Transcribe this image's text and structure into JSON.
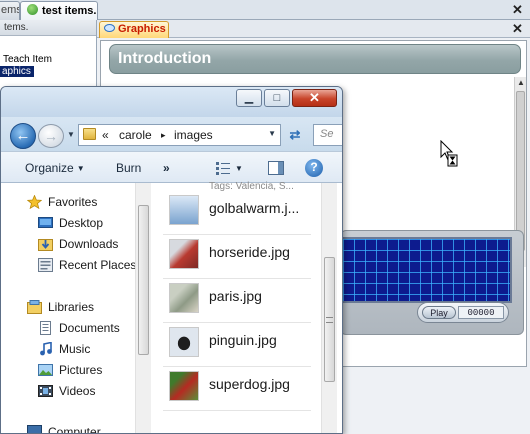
{
  "app": {
    "tabs": [
      {
        "label": "ems."
      },
      {
        "label": "test items."
      }
    ],
    "left_panel": {
      "header": "tems.",
      "tree": [
        {
          "label": "Teach Item"
        },
        {
          "label": "aphics",
          "selected": true
        }
      ]
    },
    "graphics_tab": {
      "label": "Graphics"
    },
    "slide": {
      "title": "Introduction"
    },
    "media_player": {
      "play_label": "Play",
      "counter": "00000"
    }
  },
  "explorer": {
    "window_buttons": {
      "minimize": "▁",
      "maximize": "□",
      "close": "✕"
    },
    "address": {
      "overflow": "«",
      "crumbs": [
        "carole",
        "images"
      ],
      "separator": "▸",
      "search_placeholder": "Se"
    },
    "toolbar": {
      "organize": "Organize",
      "burn": "Burn",
      "more": "»"
    },
    "nav_pane": {
      "sections": [
        {
          "id": "favorites",
          "label": "Favorites",
          "items": [
            "Desktop",
            "Downloads",
            "Recent Places"
          ]
        },
        {
          "id": "libraries",
          "label": "Libraries",
          "items": [
            "Documents",
            "Music",
            "Pictures",
            "Videos"
          ]
        },
        {
          "id": "computer",
          "label": "Computer"
        }
      ]
    },
    "files": {
      "partial_tags": "Tags: Valencia, S...",
      "items": [
        {
          "name": "golbalwarm.j..."
        },
        {
          "name": "horseride.jpg"
        },
        {
          "name": "paris.jpg"
        },
        {
          "name": "pinguin.jpg"
        },
        {
          "name": "superdog.jpg"
        }
      ]
    }
  },
  "colors": {
    "selection": "#0a246a",
    "graphics_tab_text": "#c81c00",
    "slide_title_bar": "#93a6a8",
    "media_screen": "#0d1b8e",
    "close_button": "#c8442a"
  }
}
